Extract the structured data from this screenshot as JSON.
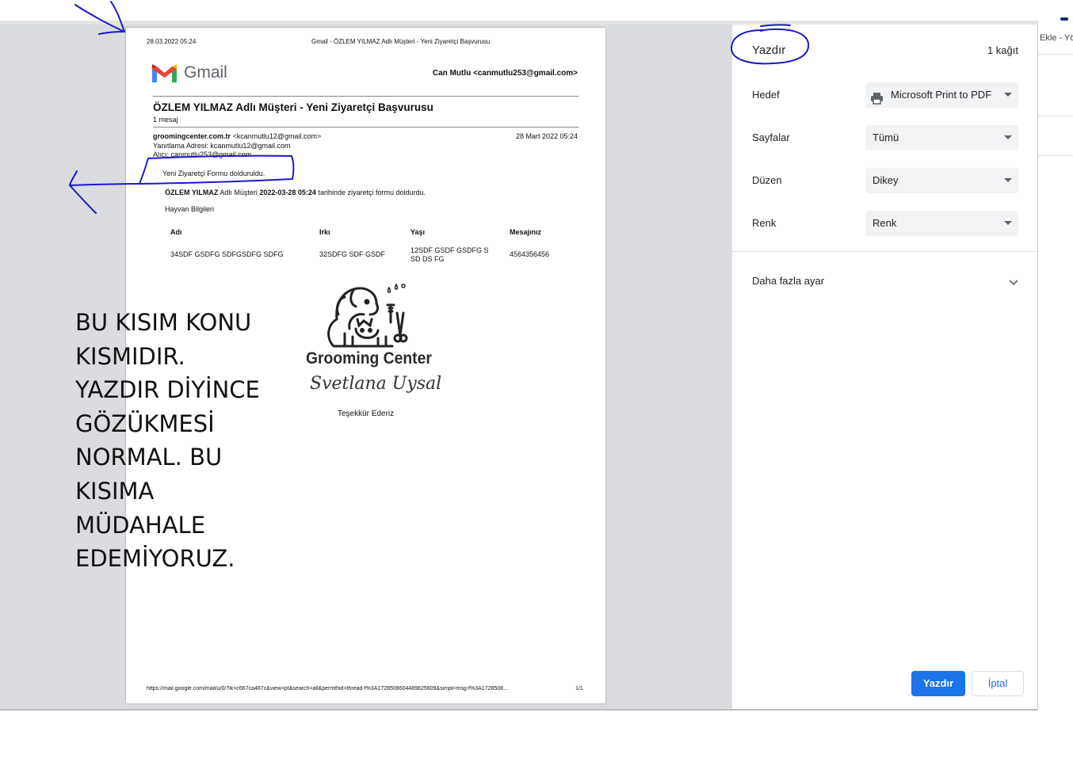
{
  "paper": {
    "header_date": "28.03.2022 05:24",
    "header_title": "Gmail - ÖZLEM YILMAZ Adlı Müşteri - Yeni Ziyaretçi Başvurusu",
    "gmail_wordmark": "Gmail",
    "recipient_header": "Can Mutlu <canmutlu253@gmail.com>",
    "subject": "ÖZLEM YILMAZ Adlı Müşteri - Yeni Ziyaretçi Başvurusu",
    "message_count": "1 mesaj",
    "sender_name": "groomingcenter.com.tr",
    "sender_email": " <kcanmutlu12@gmail.com>",
    "sent_date": "28 Mart 2022 05:24",
    "reply_to": "Yanıtlama Adresi: kcanmutlu12@gmail.com",
    "to": "Alıcı: canmutlu253@gmail.com",
    "intro": "Yeni Ziyaretçi Formu dolduruldu.",
    "body_name": "ÖZLEM YILMAZ",
    "body_mid": " Adlı Müşteri ",
    "body_date": "2022-03-28 05:24",
    "body_end": " tarihinde ziyaretçi formu doldurdu.",
    "section_title": "Hayvan Bilgileri",
    "table": {
      "headers": [
        "Adı",
        "Irkı",
        "Yaşı",
        "Mesajınız"
      ],
      "row": [
        "34SDF GSDFG SDFGSDFG SDFG",
        "32SDFG SDF GSDF",
        "12SDF GSDF GSDFG S SD DS FG",
        "4564356456"
      ]
    },
    "logo_text": "Grooming Center",
    "logo_signature": "Svetlana Uysal",
    "thanks": "Teşekkür Ederiz",
    "footer_url": "https://mail.google.com/mail/u/0/?ik=c667ca487c&view=pt&search=all&permthid=thread-f%3A1728508604489825609&simpl=msg-f%3A1728508…",
    "page_number": "1/1"
  },
  "settings": {
    "title": "Yazdır",
    "sheet_count": "1 kağıt",
    "destination_label": "Hedef",
    "destination_value": "Microsoft Print to PDF",
    "pages_label": "Sayfalar",
    "pages_value": "Tümü",
    "layout_label": "Düzen",
    "layout_value": "Dikey",
    "color_label": "Renk",
    "color_value": "Renk",
    "more_settings": "Daha fazla ayar",
    "print_button": "Yazdır",
    "cancel_button": "İptal"
  },
  "background": {
    "tab_text": "Ekle - Yö"
  },
  "annotation": {
    "text": "BU KISIM KONU\nKISMIDIR.\nYAZDIR DİYİNCE\nGÖZÜKMESİ\nNORMAL. BU\nKISIMA\nMÜDAHALE\nEDEMİYORUZ."
  },
  "colors": {
    "accent_blue": "#1a73e8",
    "pen_blue": "#1a1acc",
    "preview_bg": "#dadce0"
  }
}
